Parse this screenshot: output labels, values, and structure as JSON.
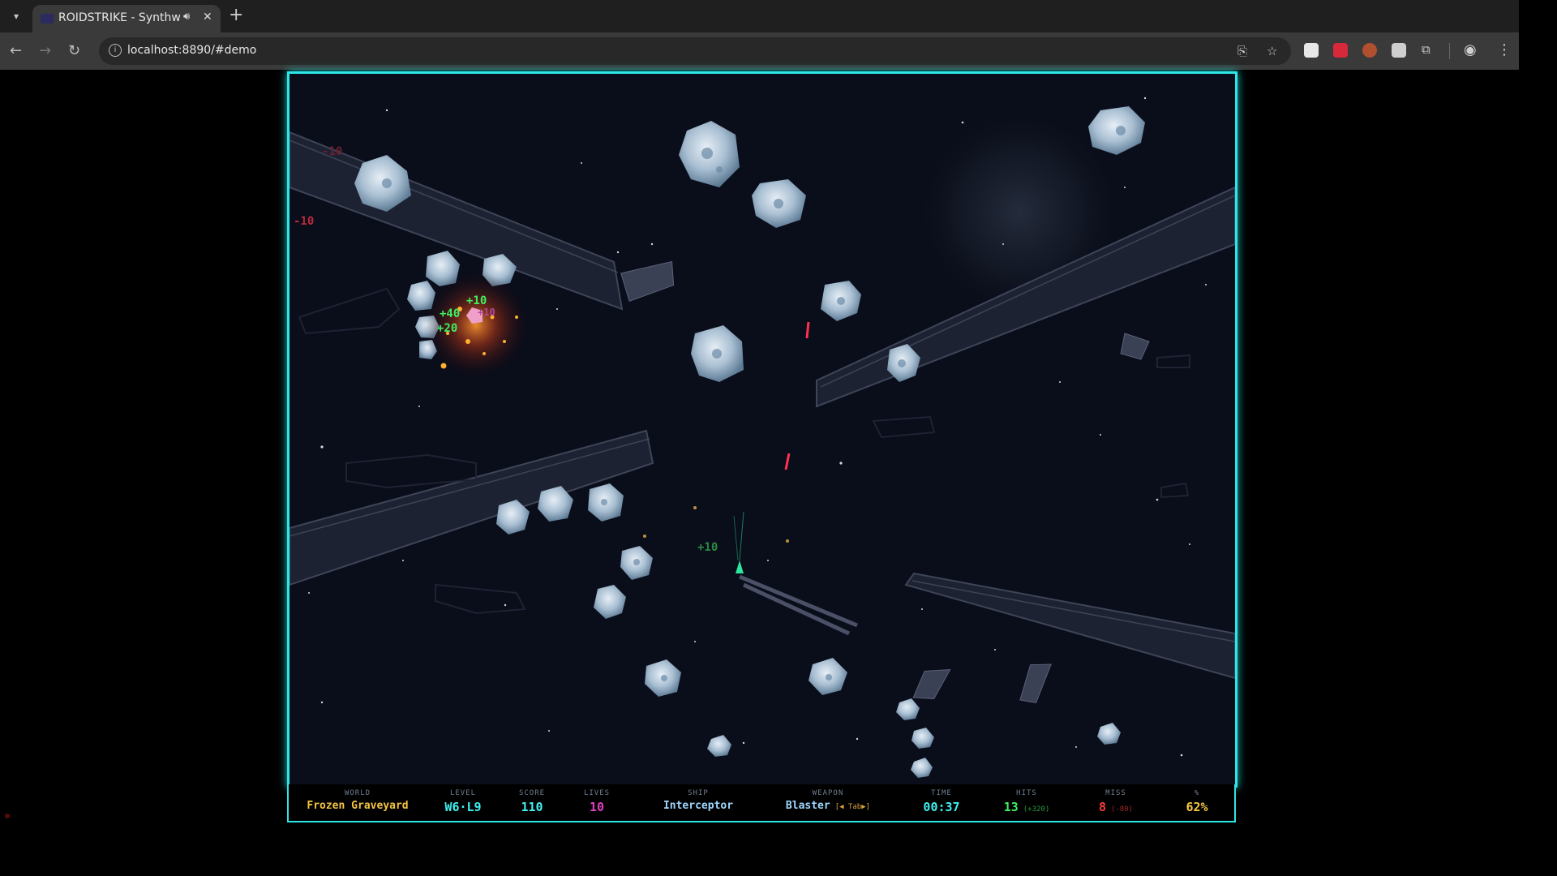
{
  "browser": {
    "tab_title": "ROIDSTRIKE - Synthw",
    "url": "localhost:8890/#demo"
  },
  "hud": {
    "world": {
      "label": "WORLD",
      "value": "Frozen Graveyard"
    },
    "level": {
      "label": "LEVEL",
      "value": "W6·L9"
    },
    "score": {
      "label": "SCORE",
      "value": "110"
    },
    "lives": {
      "label": "LIVES",
      "value": "10"
    },
    "ship": {
      "label": "SHIP",
      "value": "Interceptor"
    },
    "weapon": {
      "label": "WEAPON",
      "value": "Blaster",
      "hint": "[◀ Tab▶]"
    },
    "time": {
      "label": "TIME",
      "value": "00:37"
    },
    "hits": {
      "label": "HITS",
      "value": "13",
      "bonus": "(+320)"
    },
    "miss": {
      "label": "MISS",
      "value": "8",
      "penalty": "(-80)"
    },
    "accuracy": {
      "label": "%",
      "value": "62%"
    }
  },
  "floating_text": {
    "penalty_a": "-10",
    "penalty_b": "-10",
    "gain_a": "+10",
    "gain_b": "+40",
    "gain_c": "+20",
    "gain_d": "+10",
    "gain_near_ship": "+10"
  },
  "colors": {
    "border": "#2ee6e6",
    "world": "#f5c542",
    "level": "#3ef0f0",
    "score": "#3ef0f0",
    "lives": "#e040c0",
    "ship": "#9fd8ff",
    "weapon": "#9fd8ff",
    "time": "#3ef0f0",
    "hits": "#3ef060",
    "miss": "#ff3a3a",
    "accuracy": "#f5c542"
  }
}
